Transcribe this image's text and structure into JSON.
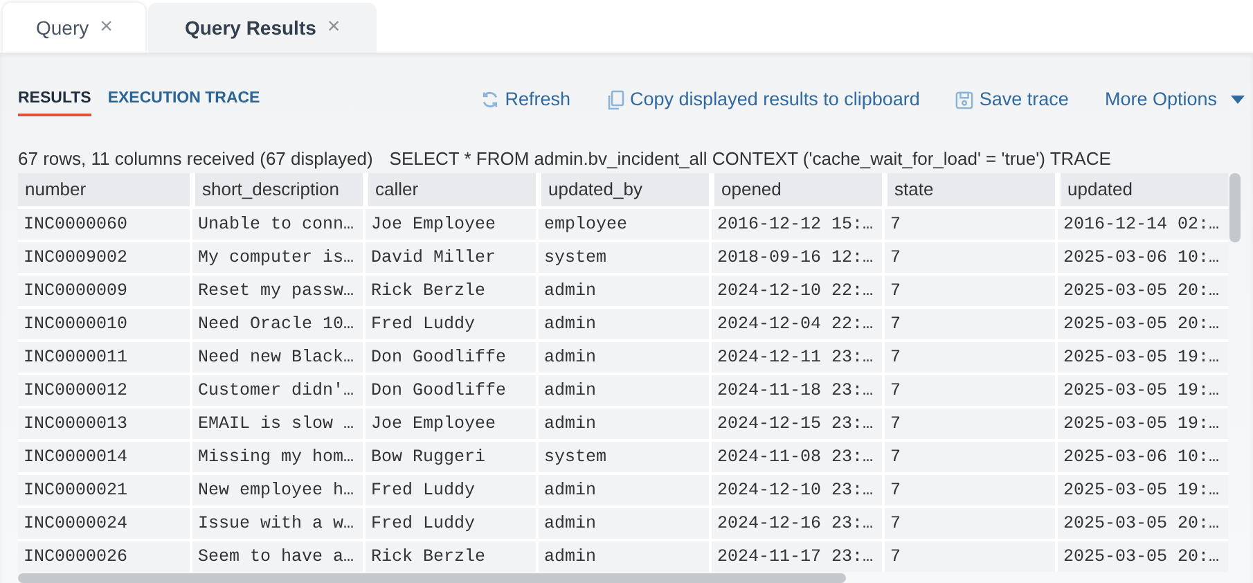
{
  "tabs": [
    {
      "label": "Query",
      "selected": false,
      "close": "×"
    },
    {
      "label": "Query Results",
      "selected": true,
      "close": "×"
    }
  ],
  "subtabs": [
    {
      "label": "RESULTS",
      "selected": true
    },
    {
      "label": "EXECUTION TRACE",
      "selected": false
    }
  ],
  "actions": [
    {
      "kind": "refresh",
      "label": "Refresh"
    },
    {
      "kind": "copy",
      "label": "Copy displayed results to clipboard"
    },
    {
      "kind": "save",
      "label": "Save trace"
    },
    {
      "kind": "menu",
      "label": "More Options"
    }
  ],
  "summary": "67 rows, 11 columns received (67 displayed)",
  "query": "SELECT * FROM admin.bv_incident_all CONTEXT ('cache_wait_for_load' = 'true') TRACE",
  "table": {
    "columns": [
      "number",
      "short_description",
      "caller",
      "updated_by",
      "opened",
      "state",
      "updated"
    ],
    "rows": [
      [
        "INC0000060",
        "Unable to conn…",
        "Joe Employee",
        "employee",
        "2016-12-12 15:…",
        "7",
        "2016-12-14 02:…"
      ],
      [
        "INC0009002",
        "My computer is…",
        "David Miller",
        "system",
        "2018-09-16 12:…",
        "7",
        "2025-03-06 10:…"
      ],
      [
        "INC0000009",
        "Reset my passw…",
        "Rick Berzle",
        "admin",
        "2024-12-10 22:…",
        "7",
        "2025-03-05 20:…"
      ],
      [
        "INC0000010",
        "Need Oracle 10…",
        "Fred Luddy",
        "admin",
        "2024-12-04 22:…",
        "7",
        "2025-03-05 20:…"
      ],
      [
        "INC0000011",
        "Need new Black…",
        "Don Goodliffe",
        "admin",
        "2024-12-11 23:…",
        "7",
        "2025-03-05 19:…"
      ],
      [
        "INC0000012",
        "Customer didn'…",
        "Don Goodliffe",
        "admin",
        "2024-11-18 23:…",
        "7",
        "2025-03-05 19:…"
      ],
      [
        "INC0000013",
        "EMAIL is slow …",
        "Joe Employee",
        "admin",
        "2024-12-15 23:…",
        "7",
        "2025-03-05 19:…"
      ],
      [
        "INC0000014",
        "Missing my hom…",
        "Bow Ruggeri",
        "system",
        "2024-11-08 23:…",
        "7",
        "2025-03-06 10:…"
      ],
      [
        "INC0000021",
        "New employee h…",
        "Fred Luddy",
        "admin",
        "2024-12-10 23:…",
        "7",
        "2025-03-05 19:…"
      ],
      [
        "INC0000024",
        "Issue with a w…",
        "Fred Luddy",
        "admin",
        "2024-12-16 23:…",
        "7",
        "2025-03-05 20:…"
      ],
      [
        "INC0000026",
        "Seem to have a…",
        "Rick Berzle",
        "admin",
        "2024-11-17 23:…",
        "7",
        "2025-03-05 20:…"
      ]
    ]
  }
}
